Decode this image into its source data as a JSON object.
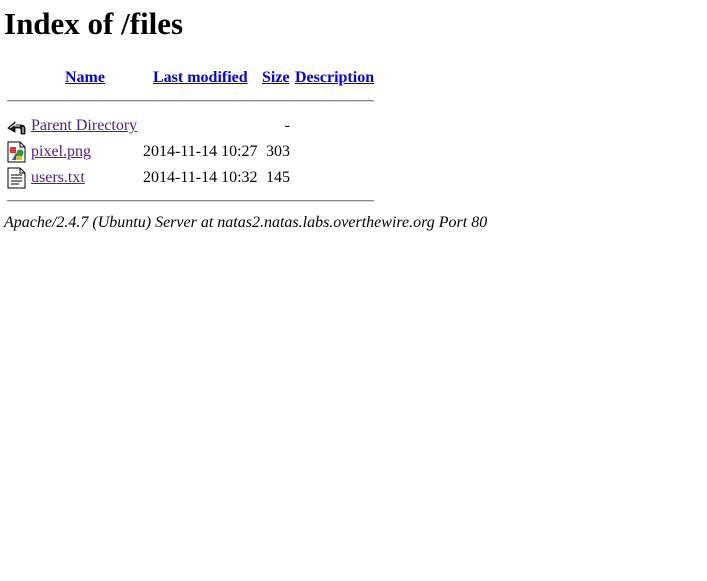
{
  "page": {
    "title": "Index of /files"
  },
  "table": {
    "headers": {
      "name": "Name",
      "last_modified": "Last modified",
      "size": "Size",
      "description": "Description"
    },
    "rows": [
      {
        "icon": "back-arrow-icon",
        "name": "Parent Directory",
        "last_modified": "",
        "size": "-",
        "description": ""
      },
      {
        "icon": "image-file-icon",
        "name": "pixel.png",
        "last_modified": "2014-11-14 10:27",
        "size": "303",
        "description": ""
      },
      {
        "icon": "text-file-icon",
        "name": "users.txt",
        "last_modified": "2014-11-14 10:32",
        "size": "145",
        "description": ""
      }
    ]
  },
  "footer": {
    "address": "Apache/2.4.7 (Ubuntu) Server at natas2.natas.labs.overthewire.org Port 80"
  },
  "colors": {
    "link": "#0000ee",
    "visited_link": "#551a8b",
    "rule": "#8a8a8a"
  }
}
